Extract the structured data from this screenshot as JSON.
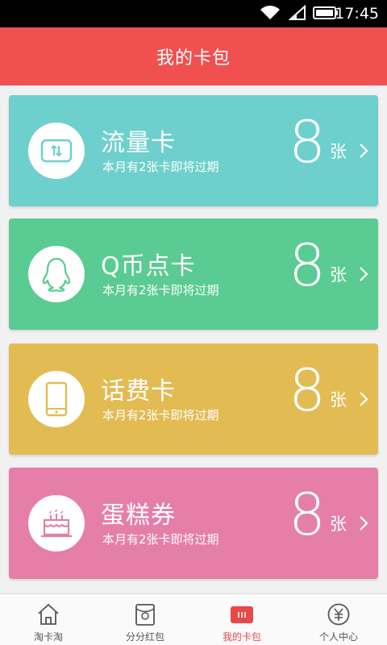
{
  "status_bar": {
    "time": "17:45",
    "icons": [
      "wifi-icon",
      "signal-icon",
      "battery-icon"
    ]
  },
  "header": {
    "title": "我的卡包"
  },
  "cards": [
    {
      "name": "流量卡",
      "note": "本月有2张卡即将过期",
      "count": "8",
      "unit": "张",
      "icon": "data-transfer-icon",
      "color": "#6dd0cc"
    },
    {
      "name": "Q币点卡",
      "note": "本月有2张卡即将过期",
      "count": "8",
      "unit": "张",
      "icon": "qq-penguin-icon",
      "color": "#5acb92"
    },
    {
      "name": "话费卡",
      "note": "本月有2张卡即将过期",
      "count": "8",
      "unit": "张",
      "icon": "phone-icon",
      "color": "#e2bb53"
    },
    {
      "name": "蛋糕券",
      "note": "本月有2张卡即将过期",
      "count": "8",
      "unit": "张",
      "icon": "cake-icon",
      "color": "#e57ea8"
    }
  ],
  "tabs": [
    {
      "label": "淘卡淘",
      "icon": "home-icon"
    },
    {
      "label": "分分红包",
      "icon": "red-packet-icon"
    },
    {
      "label": "我的卡包",
      "icon": "card-wallet-icon",
      "active": true
    },
    {
      "label": "个人中心",
      "icon": "yen-circle-icon"
    }
  ],
  "colors": {
    "header": "#f05050",
    "active_tab": "#e84848",
    "card_peek": "#9fa0e8"
  }
}
